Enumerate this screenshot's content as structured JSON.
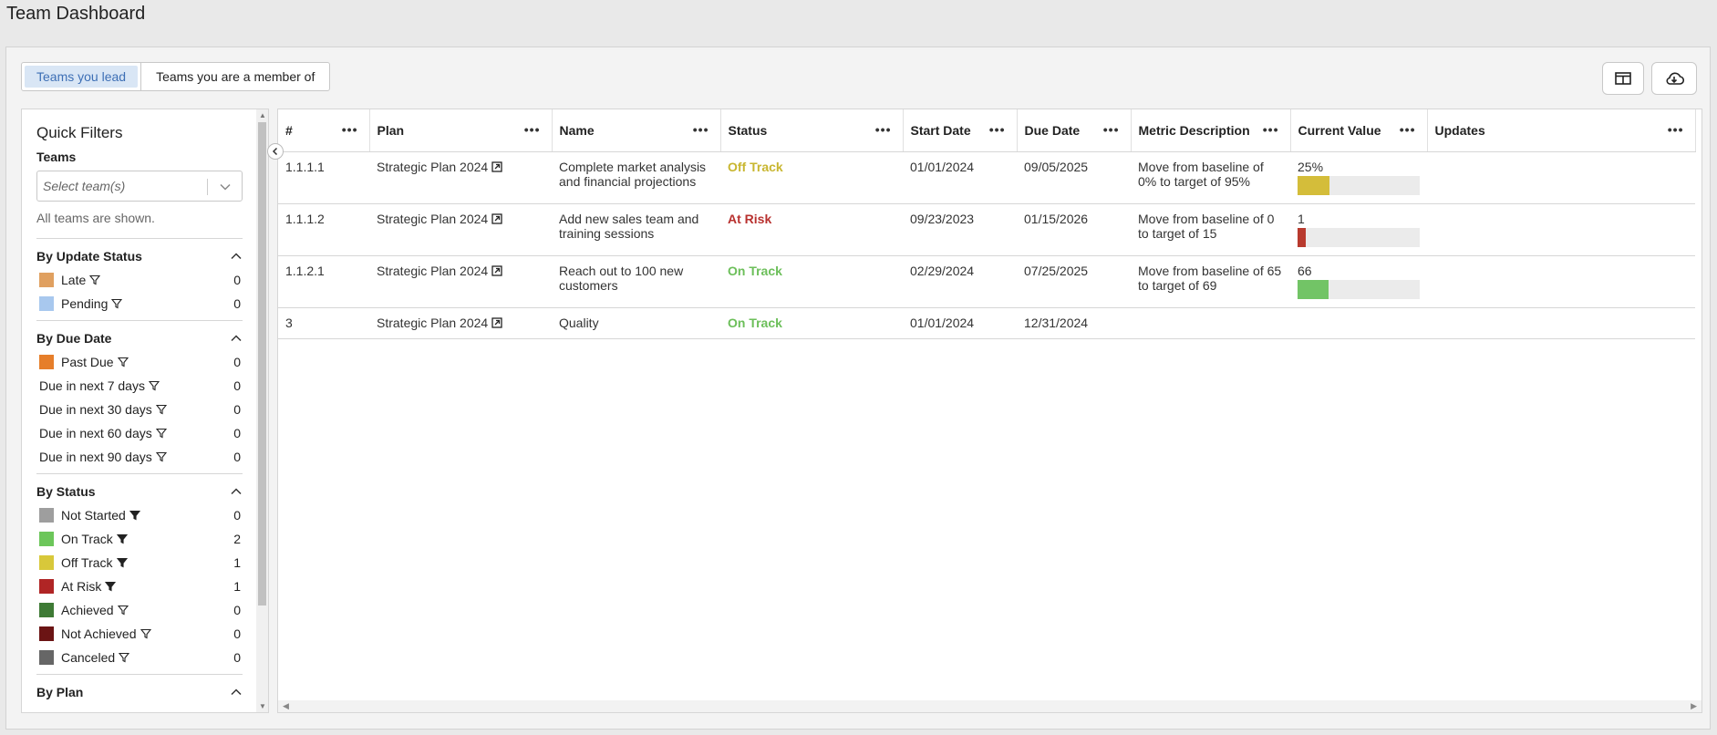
{
  "page": {
    "title": "Team Dashboard"
  },
  "tabs": [
    {
      "label": "Teams you lead",
      "active": true
    },
    {
      "label": "Teams you are a member of",
      "active": false
    }
  ],
  "toolbar": {
    "columns_icon": "columns-icon",
    "download_icon": "cloud-download-icon"
  },
  "sidebar": {
    "title": "Quick Filters",
    "teams_label": "Teams",
    "teams_placeholder": "Select team(s)",
    "teams_hint": "All teams are shown.",
    "sections": [
      {
        "title": "By Update Status",
        "items": [
          {
            "label": "Late",
            "count": "0",
            "color": "#e0a060",
            "filled": false
          },
          {
            "label": "Pending",
            "count": "0",
            "color": "#a8c8ee",
            "filled": false
          }
        ]
      },
      {
        "title": "By Due Date",
        "items": [
          {
            "label": "Past Due",
            "count": "0",
            "color": "#e67e2a",
            "filled": false
          },
          {
            "label": "Due in next 7 days",
            "count": "0",
            "color": "",
            "filled": false
          },
          {
            "label": "Due in next 30 days",
            "count": "0",
            "color": "",
            "filled": false
          },
          {
            "label": "Due in next 60 days",
            "count": "0",
            "color": "",
            "filled": false
          },
          {
            "label": "Due in next 90 days",
            "count": "0",
            "color": "",
            "filled": false
          }
        ]
      },
      {
        "title": "By Status",
        "items": [
          {
            "label": "Not Started",
            "count": "0",
            "color": "#9e9e9e",
            "filled": true
          },
          {
            "label": "On Track",
            "count": "2",
            "color": "#6cc65a",
            "filled": true
          },
          {
            "label": "Off Track",
            "count": "1",
            "color": "#d8c83a",
            "filled": true
          },
          {
            "label": "At Risk",
            "count": "1",
            "color": "#b02525",
            "filled": true
          },
          {
            "label": "Achieved",
            "count": "0",
            "color": "#3e7a35",
            "filled": false
          },
          {
            "label": "Not Achieved",
            "count": "0",
            "color": "#6b1414",
            "filled": false
          },
          {
            "label": "Canceled",
            "count": "0",
            "color": "#666666",
            "filled": false
          }
        ]
      },
      {
        "title": "By Plan",
        "items": []
      }
    ]
  },
  "grid": {
    "columns": [
      "#",
      "Plan",
      "Name",
      "Status",
      "Start Date",
      "Due Date",
      "Metric Description",
      "Current Value",
      "Updates"
    ],
    "rows": [
      {
        "num": "1.1.1.1",
        "plan": "Strategic Plan 2024",
        "name": "Complete market analysis and financial projections",
        "status": "Off Track",
        "status_key": "offtrack",
        "start": "01/01/2024",
        "due": "09/05/2025",
        "metric": "Move from baseline of 0% to target of 95%",
        "value": "25%",
        "progress": 0.26,
        "bar_color": "#d4bd3a",
        "updates": ""
      },
      {
        "num": "1.1.1.2",
        "plan": "Strategic Plan 2024",
        "name": "Add new sales team and training sessions",
        "status": "At Risk",
        "status_key": "atrisk",
        "start": "09/23/2023",
        "due": "01/15/2026",
        "metric": "Move from baseline of 0 to target of 15",
        "value": "1",
        "progress": 0.07,
        "bar_color": "#b83a2e",
        "updates": ""
      },
      {
        "num": "1.1.2.1",
        "plan": "Strategic Plan 2024",
        "name": "Reach out to 100 new customers",
        "status": "On Track",
        "status_key": "ontrack",
        "start": "02/29/2024",
        "due": "07/25/2025",
        "metric": "Move from baseline of 65 to target of 69",
        "value": "66",
        "progress": 0.25,
        "bar_color": "#72c466",
        "updates": ""
      },
      {
        "num": "3",
        "plan": "Strategic Plan 2024",
        "name": "Quality",
        "status": "On Track",
        "status_key": "ontrack",
        "start": "01/01/2024",
        "due": "12/31/2024",
        "metric": "",
        "value": "",
        "progress": null,
        "bar_color": "",
        "updates": ""
      }
    ]
  }
}
